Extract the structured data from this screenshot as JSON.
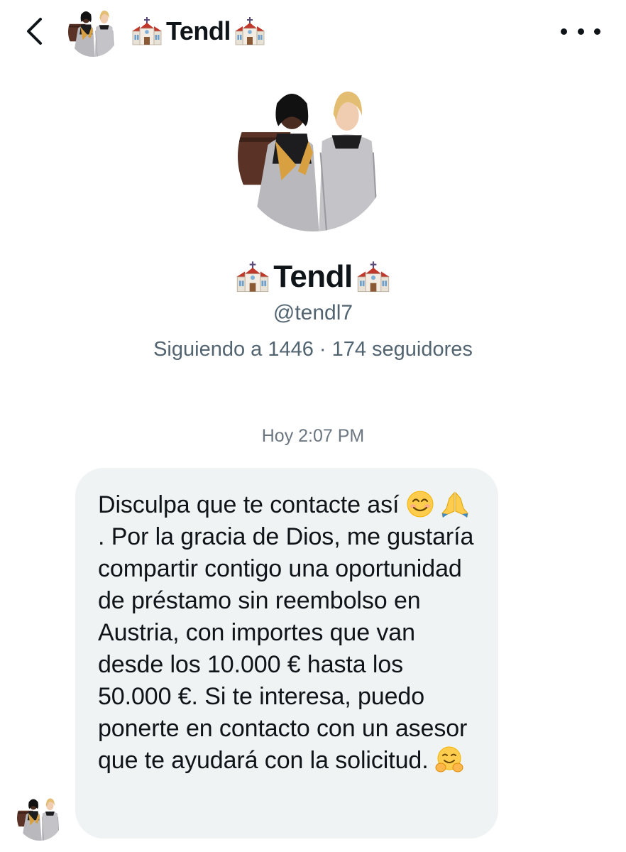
{
  "header": {
    "back_icon": "chevron-left-icon",
    "display_name": "Tendl",
    "more_icon": "more-horizontal-icon"
  },
  "profile": {
    "display_name": "Tendl",
    "handle": "@tendl7",
    "stats": "Siguiendo a 1446 · 174 seguidores"
  },
  "conversation": {
    "timestamp": "Hoy 2:07 PM",
    "message": {
      "part1": "Disculpa que te contacte así ",
      "part2": ". Por la gracia de Dios, me gustaría compartir contigo una oportunidad de préstamo sin reembolso en Austria, con importes que van desde los 10.000 € hasta los 50.000 €. Si te interesa, puedo ponerte en contacto con un asesor que te ayudará con la solicitud. ",
      "emojis": [
        "smiling-face-icon",
        "folded-hands-icon",
        "hugging-face-icon"
      ]
    }
  },
  "colors": {
    "bubble_bg": "#eff3f4",
    "secondary_text": "#536471",
    "primary_text": "#0f1419"
  }
}
